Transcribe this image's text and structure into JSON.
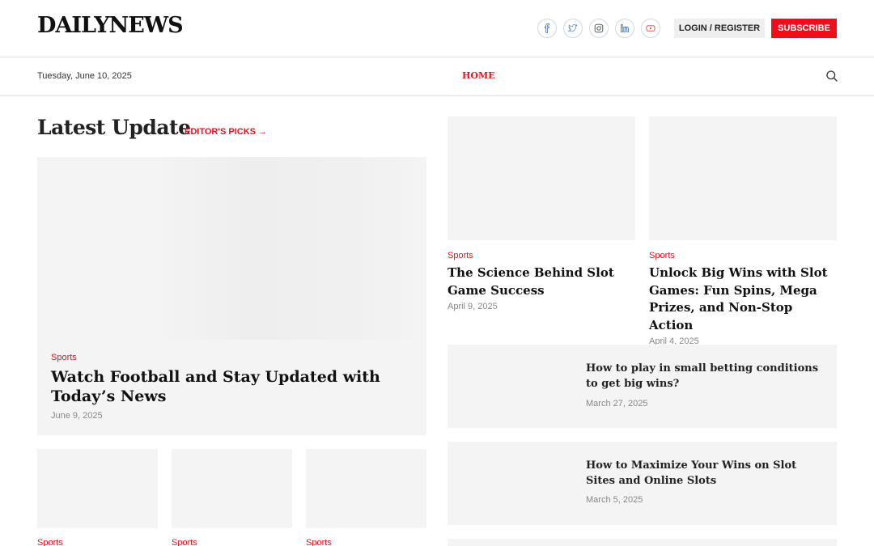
{
  "header": {
    "logo": "DAILYNEWS",
    "socials": [
      "facebook-icon",
      "twitter-icon",
      "instagram-icon",
      "linkedin-icon",
      "youtube-icon"
    ],
    "login_label": "LOGIN / REGISTER",
    "subscribe_label": "SUBSCRIBE"
  },
  "nav": {
    "date": "Tuesday, June 10, 2025",
    "home_label": "HOME"
  },
  "section": {
    "title": "Latest Update",
    "editors_picks": "EDITOR'S PICKS →"
  },
  "hero": {
    "category": "Sports",
    "title": "Watch Football and Stay Updated with Today’s News",
    "date": "June 9, 2025"
  },
  "small_cards": [
    {
      "category": "Sports"
    },
    {
      "category": "Sports"
    },
    {
      "category": "Sports"
    }
  ],
  "cards": [
    {
      "category": "Sports",
      "title": "The Science Behind Slot Game Success",
      "date": "April 9, 2025"
    },
    {
      "category": "Sports",
      "title": "Unlock Big Wins with Slot Games: Fun Spins, Mega Prizes, and Non-Stop Action",
      "date": "April 4, 2025"
    }
  ],
  "list": [
    {
      "title": "How to play in small betting conditions to get big wins?",
      "date": "March 27, 2025"
    },
    {
      "title": "How to Maximize Your Wins on Slot Sites and Online Slots",
      "date": "March 5, 2025"
    }
  ],
  "colors": {
    "accent": "#ee0e1c",
    "placeholder": "#f4f4f4"
  }
}
